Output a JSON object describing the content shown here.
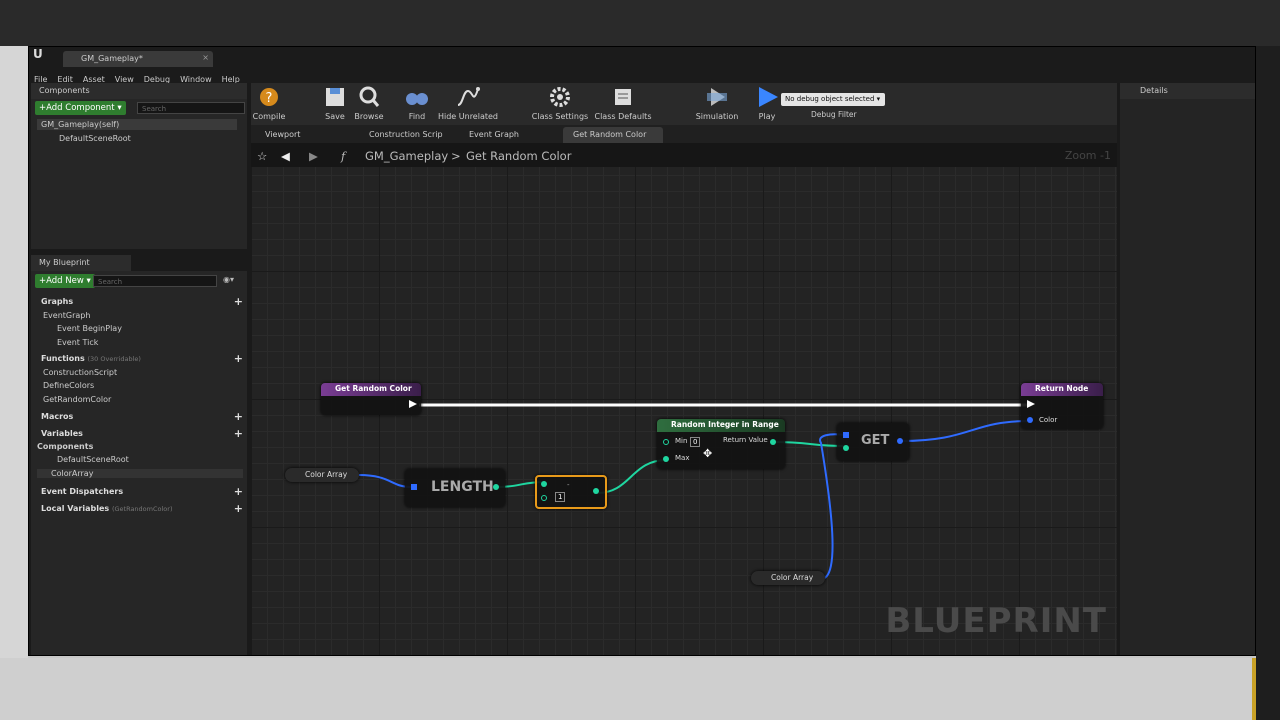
{
  "window": {
    "tab_title": "GM_Gameplay*"
  },
  "menu": [
    "File",
    "Edit",
    "Asset",
    "View",
    "Debug",
    "Window",
    "Help"
  ],
  "components": {
    "header": "Components",
    "add_button": "+Add Component ▾",
    "search_placeholder": "Search",
    "items": [
      "GM_Gameplay(self)",
      "DefaultSceneRoot"
    ]
  },
  "my_blueprint": {
    "header": "My Blueprint",
    "add_button": "+Add New ▾",
    "search_placeholder": "Search",
    "graphs": {
      "label": "Graphs",
      "event_graph": "EventGraph",
      "events": [
        "Event BeginPlay",
        "Event Tick"
      ]
    },
    "functions": {
      "label": "Functions",
      "note": "(30 Overridable)",
      "items": [
        "ConstructionScript",
        "DefineColors",
        "GetRandomColor"
      ]
    },
    "macros": "Macros",
    "variables": {
      "label": "Variables",
      "components_label": "Components",
      "items": [
        "DefaultSceneRoot",
        "ColorArray"
      ]
    },
    "event_dispatchers": "Event Dispatchers",
    "local_variables": {
      "label": "Local Variables",
      "note": "(GetRandomColor)"
    }
  },
  "toolbar": {
    "compile": "Compile",
    "save": "Save",
    "browse": "Browse",
    "find": "Find",
    "hide_unrelated": "Hide Unrelated",
    "class_settings": "Class Settings",
    "class_defaults": "Class Defaults",
    "simulation": "Simulation",
    "play": "Play",
    "debug_select": "No debug object selected ▾",
    "debug_filter": "Debug Filter"
  },
  "tabs": [
    "Viewport",
    "Construction Scrip",
    "Event Graph",
    "Get Random Color"
  ],
  "breadcrumb": {
    "blueprint": "GM_Gameplay",
    "separator": ">",
    "function": "Get Random Color"
  },
  "zoom": "Zoom -1",
  "watermark": "BLUEPRINT",
  "nodes": {
    "entry": "Get Random Color",
    "return": "Return Node",
    "return_pin": "Color",
    "random": "Random Integer in Range",
    "random_min": "Min",
    "random_min_val": "0",
    "random_max": "Max",
    "random_return": "Return Value",
    "length": "LENGTH",
    "get": "GET",
    "subtract_val": "1",
    "color_array_1": "Color Array",
    "color_array_2": "Color Array"
  },
  "details": {
    "header": "Details"
  },
  "colors": {
    "exec_wire": "#ffffff",
    "int_wire": "#1fd6a0",
    "array_wire": "#1e64ff",
    "func_header": "#7a3d94",
    "select_outline": "#e89a1a"
  }
}
